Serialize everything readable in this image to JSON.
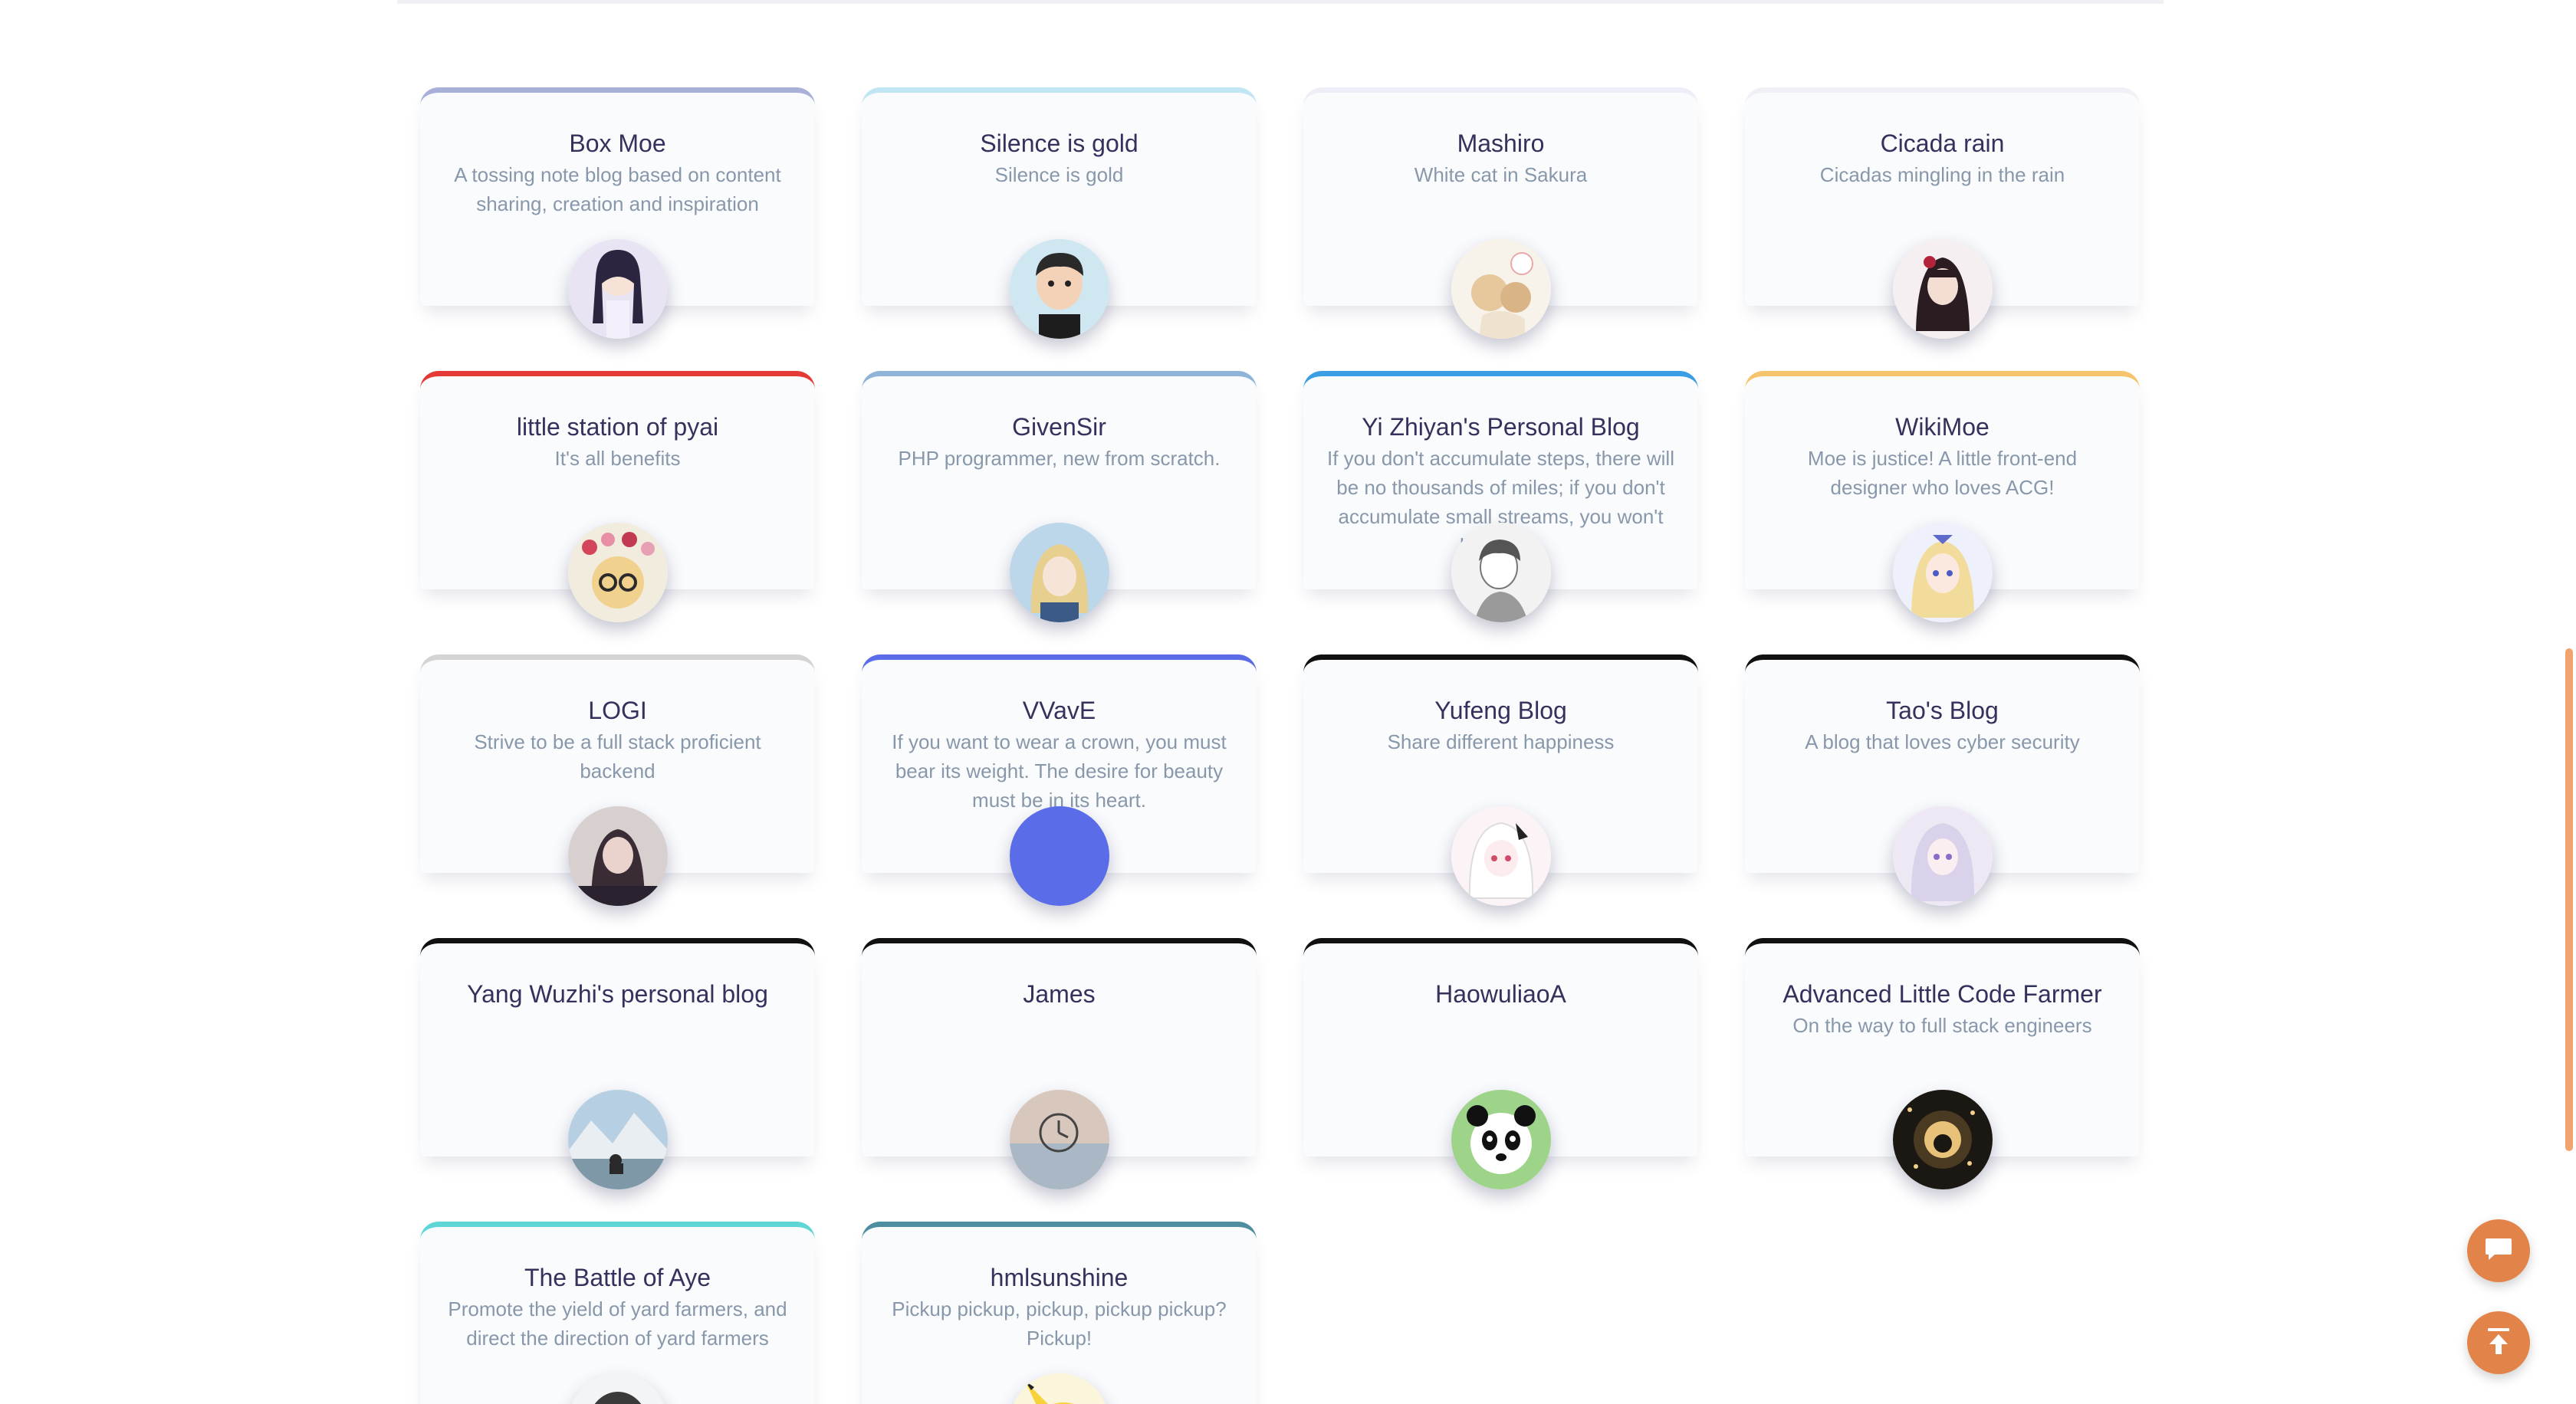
{
  "colors": {
    "accent": "#e2834a",
    "title": "#32325d",
    "muted": "#8898aa"
  },
  "links": [
    {
      "name": "Box Moe",
      "desc": "A tossing note blog based on content sharing, creation and inspiration",
      "color": "#a8b0d8",
      "avatar_icon": "anime-girl-avatar"
    },
    {
      "name": "Silence is gold",
      "desc": "Silence is gold",
      "color": "#bfe6f2",
      "avatar_icon": "cartoon-boy-avatar"
    },
    {
      "name": "Mashiro",
      "desc": "White cat in Sakura",
      "color": "#eeeef8",
      "avatar_icon": "anime-cats-avatar"
    },
    {
      "name": "Cicada rain",
      "desc": "Cicadas mingling in the rain",
      "color": "#f0f0f6",
      "avatar_icon": "anime-girl-dark-avatar"
    },
    {
      "name": "little station of pyai",
      "desc": "It's all benefits",
      "color": "#e53935",
      "avatar_icon": "flower-dog-avatar"
    },
    {
      "name": "GivenSir",
      "desc": "PHP programmer, new from scratch.",
      "color": "#8fb4d8",
      "avatar_icon": "anime-blonde-avatar"
    },
    {
      "name": "Yi Zhiyan's Personal Blog",
      "desc": "If you don't accumulate steps, there will be no thousands of miles; if you don't accumulate small streams, you won't be a sea.",
      "color": "#3a9ee4",
      "avatar_icon": "sketch-boy-avatar"
    },
    {
      "name": "WikiMoe",
      "desc": "Moe is justice! A little front-end designer who loves ACG!",
      "color": "#f6c46a",
      "avatar_icon": "anime-blonde-girl-avatar"
    },
    {
      "name": "LOGI",
      "desc": "Strive to be a full stack proficient backend",
      "color": "#d4d4d4",
      "avatar_icon": "photo-person-avatar"
    },
    {
      "name": "VVavE",
      "desc": "If you want to wear a crown, you must bear its weight. The desire for beauty must be in its heart.",
      "color": "#5b6ce8",
      "avatar_icon": "blue-circle-avatar"
    },
    {
      "name": "Yufeng Blog",
      "desc": "Share different happiness",
      "color": "#111111",
      "avatar_icon": "anime-white-hair-avatar"
    },
    {
      "name": "Tao's Blog",
      "desc": "A blog that loves cyber security",
      "color": "#111111",
      "avatar_icon": "anime-silver-girl-avatar"
    },
    {
      "name": "Yang Wuzhi's personal blog",
      "desc": "",
      "color": "#111111",
      "avatar_icon": "mountain-photo-avatar"
    },
    {
      "name": "James",
      "desc": "",
      "color": "#111111",
      "avatar_icon": "watch-tattoo-avatar"
    },
    {
      "name": "HaowuliaoA",
      "desc": "",
      "color": "#111111",
      "avatar_icon": "panda-avatar"
    },
    {
      "name": "Advanced Little Code Farmer",
      "desc": "On the way to full stack engineers",
      "color": "#111111",
      "avatar_icon": "sparkle-tunnel-avatar"
    },
    {
      "name": "The Battle of Aye",
      "desc": "Promote the yield of yard farmers, and direct the direction of yard farmers",
      "color": "#5ed6d6",
      "avatar_icon": "penguin-avatar"
    },
    {
      "name": "hmlsunshine",
      "desc": "Pickup pickup, pickup, pickup pickup? Pickup!",
      "color": "#4f8ea0",
      "avatar_icon": "pikachu-avatar"
    }
  ],
  "floating_buttons": {
    "chat_icon": "chat-bubble-icon",
    "top_icon": "back-to-top-icon"
  }
}
